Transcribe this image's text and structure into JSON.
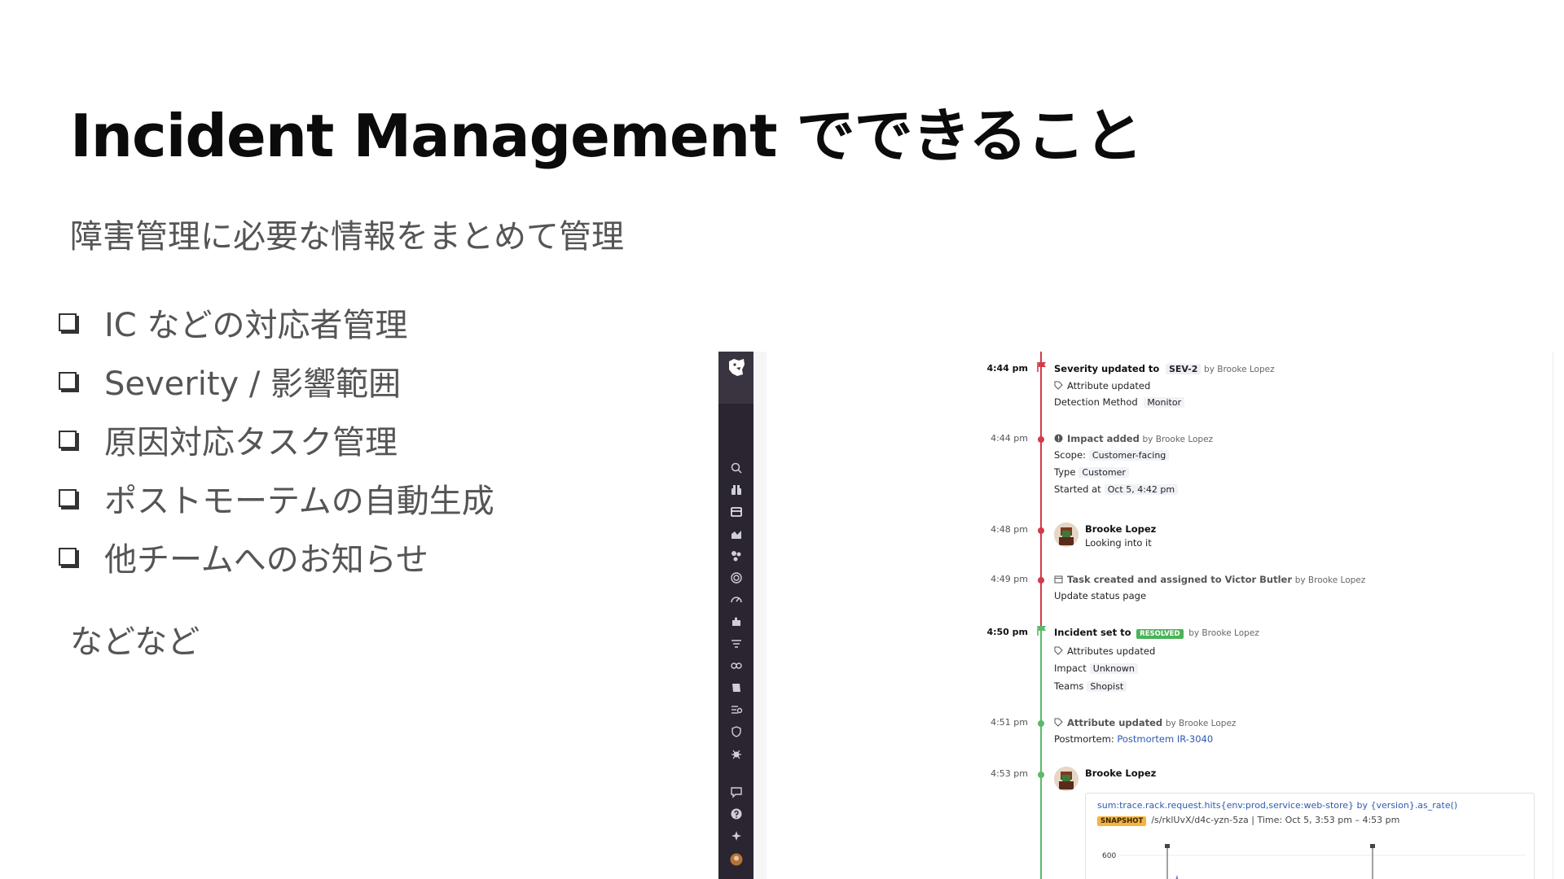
{
  "slide": {
    "title": "Incident Management でできること",
    "subtitle": "障害管理に必要な情報をまとめて管理",
    "bullets": [
      "IC などの対応者管理",
      "Severity / 影響範囲",
      "原因対応タスク管理",
      "ポストモーテムの自動生成",
      "他チームへのお知らせ"
    ],
    "etc": "などなど"
  },
  "timeline": {
    "colors": {
      "red": "#d33a4a",
      "green": "#5bb96a",
      "resolved": "#4bb35a",
      "snapshot": "#f5b342",
      "sidebar": "#2a2530"
    },
    "events": [
      {
        "time": "4:44 pm",
        "title_prefix": "Severity updated to",
        "severity": "SEV-2",
        "by": "by Brooke Lopez",
        "sub_title": "Attribute updated",
        "field_label": "Detection Method",
        "field_value": "Monitor"
      },
      {
        "time": "4:44 pm",
        "title": "Impact added",
        "by": "by Brooke Lopez",
        "scope_label": "Scope:",
        "scope_value": "Customer-facing",
        "type_label": "Type",
        "type_value": "Customer",
        "started_label": "Started at",
        "started_value": "Oct 5, 4:42 pm"
      },
      {
        "time": "4:48 pm",
        "user": "Brooke Lopez",
        "message": "Looking into it"
      },
      {
        "time": "4:49 pm",
        "title": "Task created and assigned to Victor Butler",
        "by": "by Brooke Lopez",
        "detail": "Update status page"
      },
      {
        "time": "4:50 pm",
        "title_prefix": "Incident set to",
        "status": "RESOLVED",
        "by": "by Brooke Lopez",
        "sub_title": "Attributes updated",
        "impact_label": "Impact",
        "impact_value": "Unknown",
        "teams_label": "Teams",
        "teams_value": "Shopist"
      },
      {
        "time": "4:51 pm",
        "title": "Attribute updated",
        "by": "by Brooke Lopez",
        "postmortem_label": "Postmortem:",
        "postmortem_value": "Postmortem IR-3040"
      },
      {
        "time": "4:53 pm",
        "user": "Brooke Lopez",
        "query": "sum:trace.rack.request.hits{env:prod,service:web-store} by {version}.as_rate()",
        "snapshot_label": "SNAPSHOT",
        "snapshot_path": "/s/rklUvX/d4c-yzn-5za  |  Time: Oct 5, 3:53 pm – 4:53 pm",
        "y_tick": "600"
      }
    ]
  },
  "sidebar_icons": [
    "search-icon",
    "binoculars-icon",
    "dashboard-icon",
    "chart-icon",
    "services-icon",
    "target-icon",
    "gauge-icon",
    "puzzle-icon",
    "filter-icon",
    "link-icon",
    "book-icon",
    "logs-icon",
    "shield-icon",
    "bug-icon",
    "chat-icon",
    "help-icon",
    "sparkle-icon",
    "user-avatar"
  ]
}
